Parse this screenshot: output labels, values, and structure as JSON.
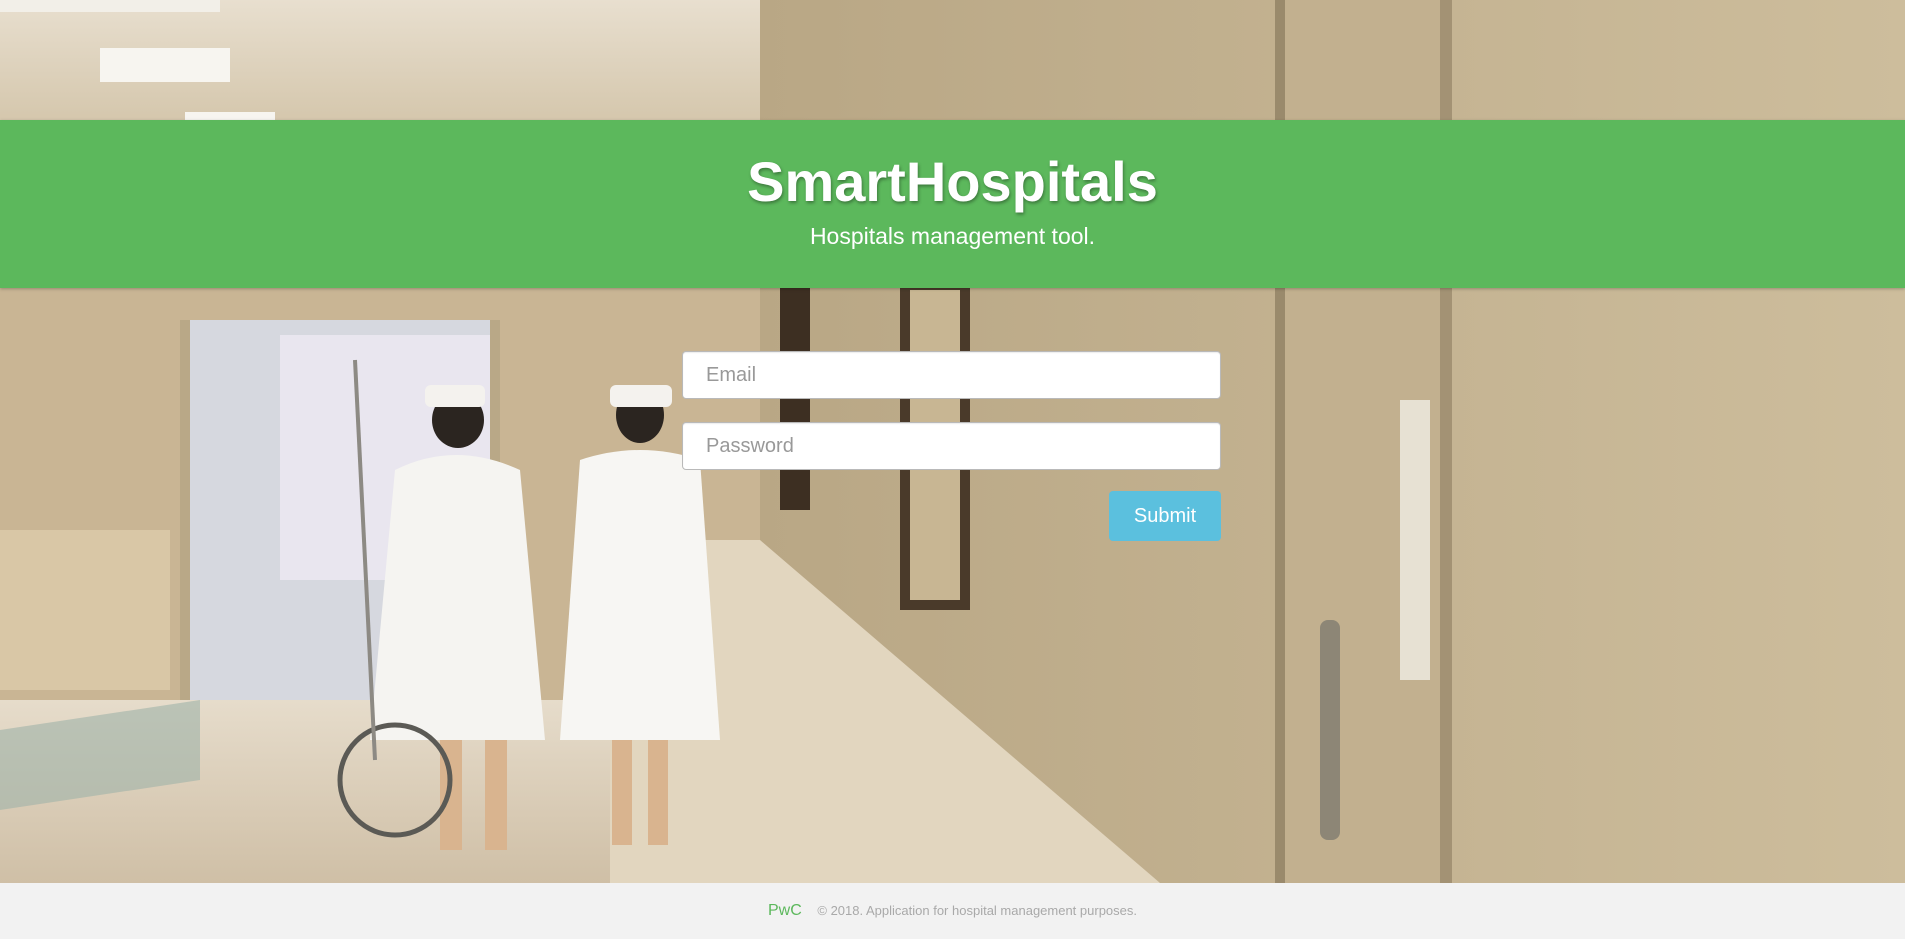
{
  "header": {
    "title": "SmartHospitals",
    "subtitle": "Hospitals management tool."
  },
  "login": {
    "email_placeholder": "Email",
    "email_value": "",
    "password_placeholder": "Password",
    "password_value": "",
    "submit_label": "Submit"
  },
  "footer": {
    "brand": "PwC",
    "copyright": "© 2018. Application for hospital management purposes."
  },
  "colors": {
    "header_green": "#5cb85c",
    "submit_blue": "#5bc0de",
    "footer_bg": "#f2f2f2"
  },
  "background": {
    "description_icon": "hospital-corridor-photo"
  }
}
